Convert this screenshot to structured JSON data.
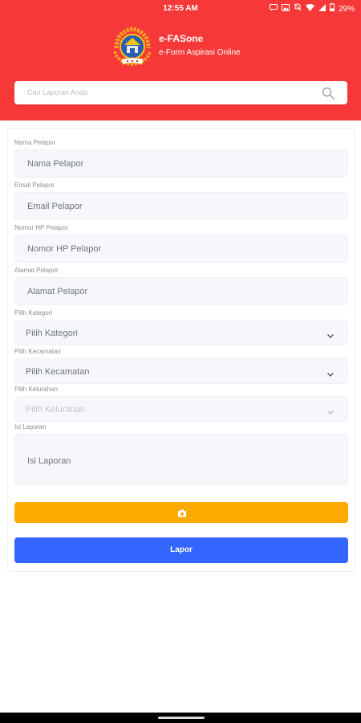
{
  "status_bar": {
    "time": "12:55 AM",
    "battery": "29%",
    "icons": [
      "message-icon",
      "photo-icon",
      "mute-icon",
      "wifi-icon",
      "signal-icon",
      "battery-icon"
    ]
  },
  "header": {
    "title": "e-FASone",
    "subtitle": "e-Form Aspirasi Online",
    "brand_color": "#f73838"
  },
  "search": {
    "placeholder": "Cari Laporan Anda"
  },
  "form": {
    "fields": [
      {
        "label": "Nama Pelapor",
        "placeholder": "Nama Pelapor"
      },
      {
        "label": "Email Pelapor",
        "placeholder": "Email Pelapor"
      },
      {
        "label": "Nomor HP Pelapor",
        "placeholder": "Nomor HP Pelapor"
      },
      {
        "label": "Alamat Pelapor",
        "placeholder": "Alamat Pelapor"
      },
      {
        "label": "Pilih Kategori",
        "placeholder": "Pilih Kategori"
      },
      {
        "label": "Pilih Kecamatan",
        "placeholder": "Pilih Kecamatan"
      },
      {
        "label": "Pilih Kelurahan",
        "placeholder": "Pilih Kelurahan"
      },
      {
        "label": "Isi Laporan",
        "placeholder": "Isi Laporan"
      }
    ],
    "photo_button_color": "#ffaa00",
    "submit_label": "Lapor",
    "submit_color": "#3366ff"
  }
}
